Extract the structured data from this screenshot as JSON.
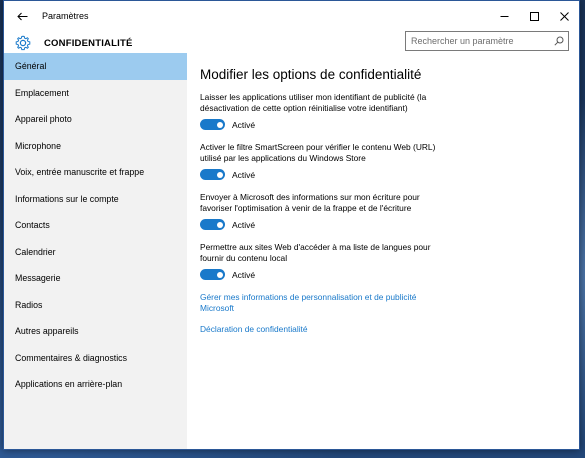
{
  "window": {
    "title": "Paramètres"
  },
  "header": {
    "section_title": "CONFIDENTIALITÉ",
    "search_placeholder": "Rechercher un paramètre"
  },
  "sidebar": {
    "items": [
      {
        "label": "Général",
        "active": true
      },
      {
        "label": "Emplacement",
        "active": false
      },
      {
        "label": "Appareil photo",
        "active": false
      },
      {
        "label": "Microphone",
        "active": false
      },
      {
        "label": "Voix, entrée manuscrite et frappe",
        "active": false
      },
      {
        "label": "Informations sur le compte",
        "active": false
      },
      {
        "label": "Contacts",
        "active": false
      },
      {
        "label": "Calendrier",
        "active": false
      },
      {
        "label": "Messagerie",
        "active": false
      },
      {
        "label": "Radios",
        "active": false
      },
      {
        "label": "Autres appareils",
        "active": false
      },
      {
        "label": "Commentaires & diagnostics",
        "active": false
      },
      {
        "label": "Applications en arrière-plan",
        "active": false
      }
    ]
  },
  "main": {
    "heading": "Modifier les options de confidentialité",
    "settings": [
      {
        "description": "Laisser les applications utiliser mon identifiant de publicité (la désactivation de cette option réinitialise votre identifiant)",
        "state_label": "Activé"
      },
      {
        "description": "Activer le filtre SmartScreen pour vérifier le contenu Web (URL) utilisé par les applications du Windows Store",
        "state_label": "Activé"
      },
      {
        "description": "Envoyer à Microsoft des informations sur mon écriture pour favoriser l'optimisation à venir de la frappe et de l'écriture",
        "state_label": "Activé"
      },
      {
        "description": "Permettre aux sites Web d'accéder à ma liste de langues pour fournir du contenu local",
        "state_label": "Activé"
      }
    ],
    "links": {
      "manage_ads": "Gérer mes informations de personnalisation et de publicité Microsoft",
      "privacy_statement": "Déclaration de confidentialité"
    }
  },
  "colors": {
    "accent": "#1979ca",
    "selected_nav": "#9ccbef",
    "sidebar_bg": "#f2f2f2"
  },
  "icons": {
    "back": "arrow-left-icon",
    "settings": "gear-icon",
    "search": "search-icon",
    "minimize": "minimize-icon",
    "maximize": "maximize-icon",
    "close": "close-icon"
  }
}
